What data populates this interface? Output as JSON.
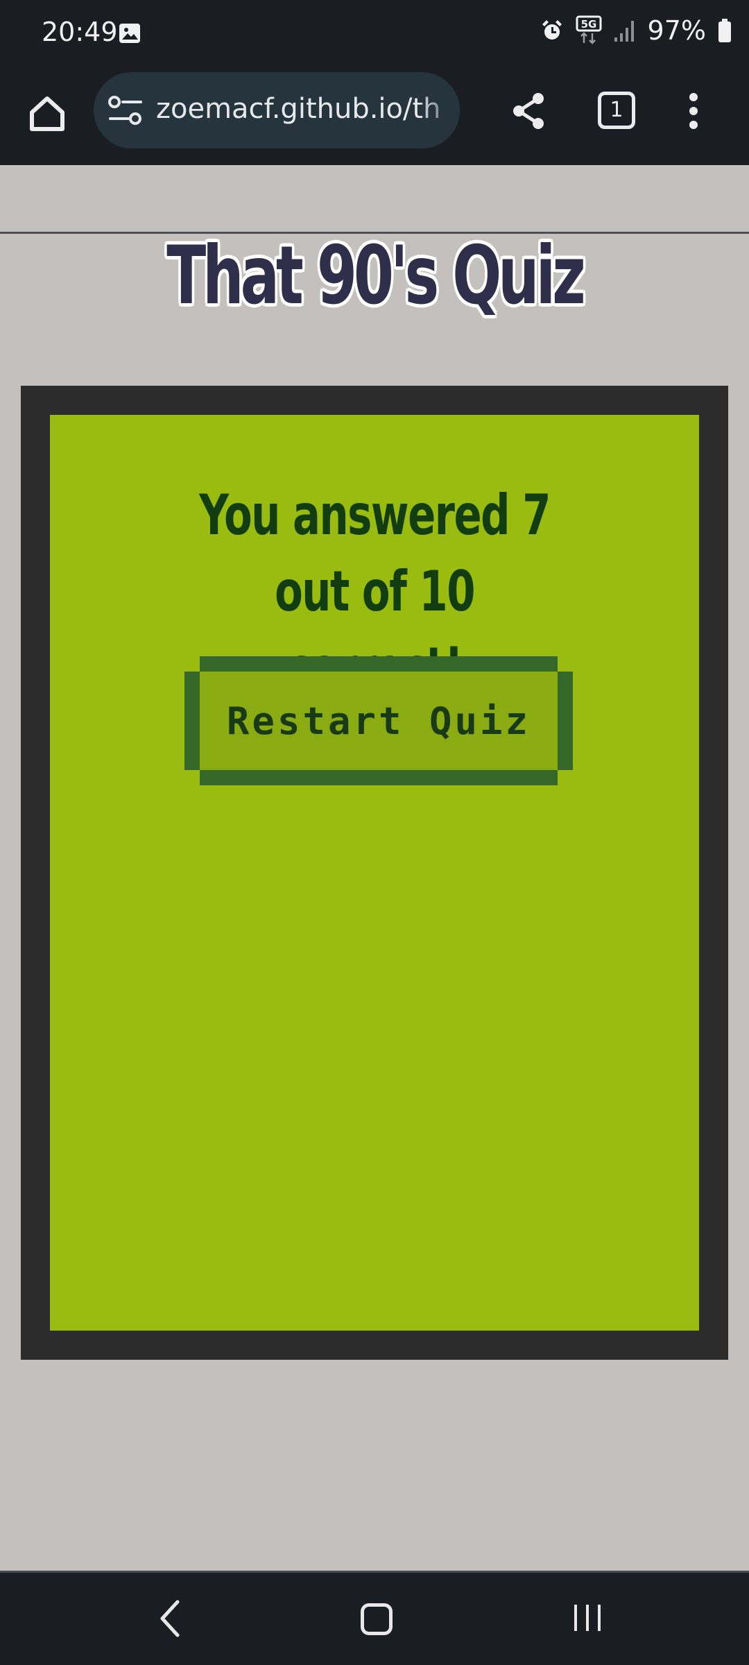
{
  "status_bar": {
    "time": "20:49",
    "network": "5G",
    "battery": "97%",
    "icons": [
      "gallery-icon",
      "alarm-icon",
      "5g-icon",
      "signal-icon",
      "battery-icon"
    ]
  },
  "browser": {
    "url": "zoemacf.github.io/th",
    "tab_count": "1",
    "icons": [
      "home-icon",
      "site-settings-icon",
      "share-icon",
      "tabs-icon",
      "more-vert-icon"
    ]
  },
  "page": {
    "title": "That 90's Quiz",
    "result": {
      "line1": "You answered 7 out of 10",
      "line2": "correct!"
    },
    "restart_label": "Restart Quiz"
  },
  "colors": {
    "page_bg": "#c4c0bd",
    "frame": "#2c2c2c",
    "screen": "#9abb10",
    "button_border": "#356828",
    "button_fill": "#8aac12",
    "text_dark_green": "#123d11",
    "title": "#2f2e4b"
  },
  "nav": {
    "icons": [
      "back-icon",
      "home-nav-icon",
      "recents-icon"
    ]
  }
}
